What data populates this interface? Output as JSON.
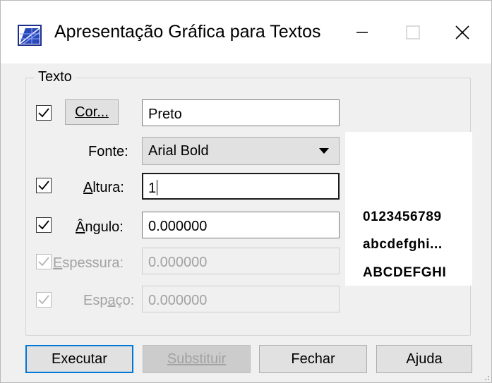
{
  "window": {
    "title": "Apresentação Gráfica para Textos",
    "icon": "app-chart-icon",
    "controls": {
      "minimize": "—",
      "close": "✕"
    }
  },
  "group": {
    "label": "Texto"
  },
  "cor": {
    "checked": true,
    "button_label": "Cor...",
    "value": "Preto"
  },
  "fonte": {
    "label": "Fonte:",
    "selected": "Arial Bold"
  },
  "altura": {
    "checked": true,
    "label": "Altura:",
    "value": "1"
  },
  "angulo": {
    "checked": true,
    "label": "Ângulo:",
    "value": "0.000000"
  },
  "espessura": {
    "checked": true,
    "disabled": true,
    "label": "Espessura:",
    "value": "0.000000"
  },
  "espaco": {
    "checked": true,
    "disabled": true,
    "label": "Espaço:",
    "value": "0.000000"
  },
  "preview": {
    "lines": [
      "0123456789",
      "abcdefghi...",
      "ABCDEFGHI"
    ]
  },
  "buttons": {
    "executar": "Executar",
    "substituir": "Substituir",
    "fechar": "Fechar",
    "ajuda": "Ajuda"
  },
  "colors": {
    "accent": "#0078d7",
    "window_bg": "#f0f0f0",
    "disabled_text": "#a2a2a2"
  }
}
